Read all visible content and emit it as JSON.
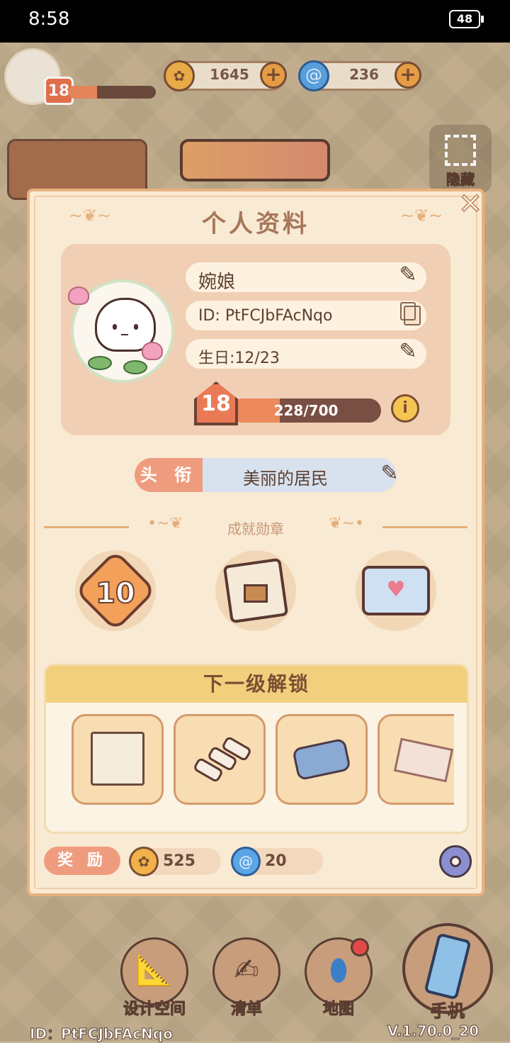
{
  "status_bar": {
    "time": "8:58",
    "battery": "48"
  },
  "hud": {
    "player_level": "18",
    "xp_fraction": 0.33,
    "coins": "1645",
    "gems": "236"
  },
  "background": {
    "hide_label": "隐藏"
  },
  "profile": {
    "title": "个人资料",
    "name": "婉娘",
    "id_line": "ID: PtFCJbFAcNqo",
    "birthday": "生日:12/23",
    "level": "18",
    "xp_text": "228/700",
    "xp_current": 228,
    "xp_max": 700,
    "title_tag": "头 衔",
    "title_value": "美丽的居民",
    "achievements_label": "成就勋章",
    "medal_level_badge": "10",
    "next_unlock_label": "下一级解锁",
    "unlock_items": [
      "cabinet-icon",
      "chalk-sticks-icon",
      "tissue-box-icon",
      "painting-icon"
    ],
    "reward_label": "奖 励",
    "reward_coins": "525",
    "reward_gems": "20"
  },
  "nav": {
    "design_space": "设计空间",
    "list": "清单",
    "map": "地图",
    "phone": "手机"
  },
  "footer": {
    "id": "ID：PtFCJbFAcNqo",
    "version": "V.1.70.0_20"
  },
  "colors": {
    "accent": "#ef9c7e",
    "panel": "#f9ead4",
    "xp_fill": "#ec8a5d",
    "banner": "#f1cf7c"
  }
}
